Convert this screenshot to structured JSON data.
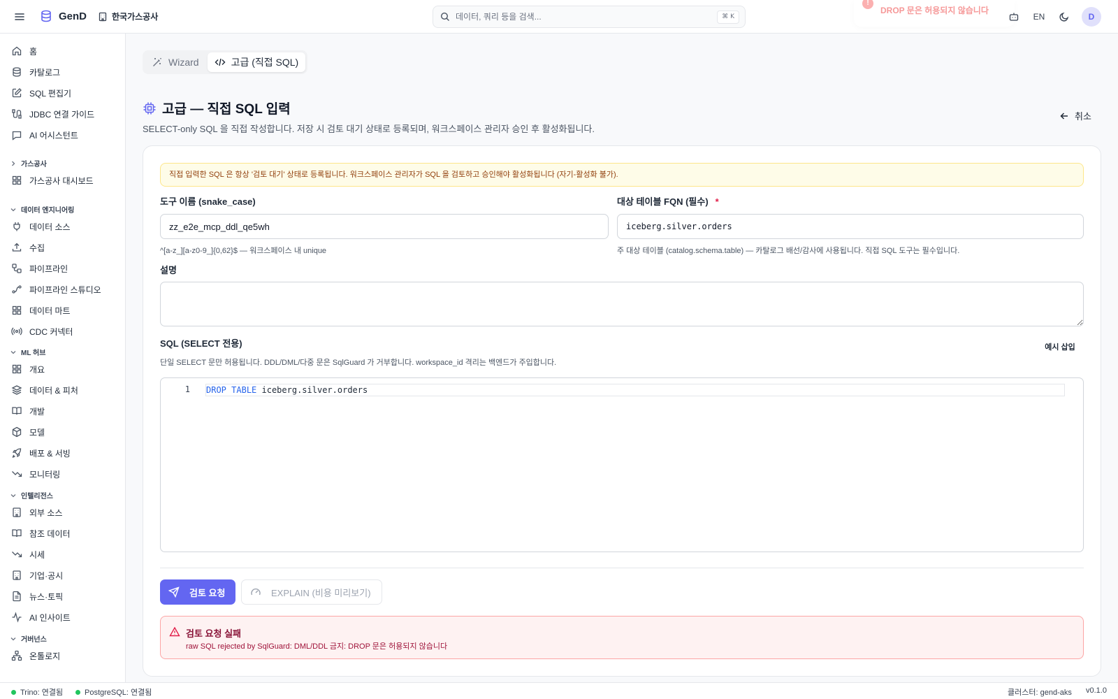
{
  "topbar": {
    "app_name": "GenD",
    "org_name": "한국가스공사",
    "search_placeholder": "데이터, 쿼리 등을 검색...",
    "search_shortcut": "⌘ K",
    "toast_message": "DROP 문은 허용되지 않습니다",
    "lang": "EN",
    "avatar_initial": "D"
  },
  "sidebar": {
    "items_top": [
      {
        "label": "홈",
        "icon": "home-icon"
      },
      {
        "label": "카탈로그",
        "icon": "database-icon"
      },
      {
        "label": "SQL 편집기",
        "icon": "edit-icon"
      },
      {
        "label": "JDBC 연결 가이드",
        "icon": "cable-icon"
      },
      {
        "label": "AI 어시스턴트",
        "icon": "message-icon"
      }
    ],
    "groups": [
      {
        "label": "가스공사",
        "items": [
          {
            "label": "가스공사 대시보드",
            "icon": "grid-icon"
          }
        ]
      },
      {
        "label": "데이터 엔지니어링",
        "items": [
          {
            "label": "데이터 소스",
            "icon": "plug-icon"
          },
          {
            "label": "수집",
            "icon": "upload-icon"
          },
          {
            "label": "파이프라인",
            "icon": "workflow-icon"
          },
          {
            "label": "파이프라인 스튜디오",
            "icon": "spline-icon"
          },
          {
            "label": "데이터 마트",
            "icon": "grid-icon"
          },
          {
            "label": "CDC 커넥터",
            "icon": "radio-icon"
          }
        ]
      },
      {
        "label": "ML 허브",
        "items": [
          {
            "label": "개요",
            "icon": "grid-icon"
          },
          {
            "label": "데이터 & 피처",
            "icon": "layers-icon"
          },
          {
            "label": "개발",
            "icon": "book-open-icon"
          },
          {
            "label": "모델",
            "icon": "box-icon"
          },
          {
            "label": "배포 & 서빙",
            "icon": "rocket-icon"
          },
          {
            "label": "모니터링",
            "icon": "trending-down-icon"
          }
        ]
      },
      {
        "label": "인텔리전스",
        "items": [
          {
            "label": "외부 소스",
            "icon": "building-icon"
          },
          {
            "label": "참조 데이터",
            "icon": "book-open-icon"
          },
          {
            "label": "시세",
            "icon": "trending-down-icon"
          },
          {
            "label": "기업·공시",
            "icon": "building-icon"
          },
          {
            "label": "뉴스·토픽",
            "icon": "file-text-icon"
          },
          {
            "label": "AI 인사이트",
            "icon": "activity-icon"
          }
        ]
      },
      {
        "label": "거버넌스",
        "items": [
          {
            "label": "온톨로지",
            "icon": "network-icon"
          }
        ]
      }
    ]
  },
  "tabs": [
    {
      "label": "Wizard"
    },
    {
      "label": "고급 (직접 SQL)"
    }
  ],
  "page": {
    "title": "고급 — 직접 SQL 입력",
    "description": "SELECT-only SQL 을 직접 작성합니다. 저장 시 검토 대기 상태로 등록되며, 워크스페이스 관리자 승인 후 활성화됩니다.",
    "cancel_label": "취소"
  },
  "form": {
    "notice": "직접 입력한 SQL 은 항상 '검토 대기' 상태로 등록됩니다. 워크스페이스 관리자가 SQL 을 검토하고 승인해야 활성화됩니다 (자기-활성화 불가).",
    "tool_name_label": "도구 이름 (snake_case)",
    "tool_name_value": "zz_e2e_mcp_ddl_qe5wh",
    "tool_name_hint": "^[a-z_][a-z0-9_]{0,62}$ — 워크스페이스 내 unique",
    "fqn_label": "대상 테이블 FQN (필수)",
    "fqn_required_mark": "*",
    "fqn_value": "iceberg.silver.orders",
    "fqn_hint": "주 대상 테이블 (catalog.schema.table) — 카탈로그 배선/감사에 사용됩니다. 직접 SQL 도구는 필수입니다.",
    "desc_label": "설명",
    "desc_value": "",
    "sql_label": "SQL (SELECT 전용)",
    "sql_example_label": "예시 삽입",
    "sql_hint": "단일 SELECT 문만 허용됩니다. DDL/DML/다중 문은 SqlGuard 가 거부합니다. workspace_id 격리는 백엔드가 주입합니다.",
    "sql_line_no": "1",
    "sql_kw1": "DROP",
    "sql_kw2": "TABLE",
    "sql_rest": "iceberg.silver.orders",
    "submit_label": "검토 요청",
    "explain_label": "EXPLAIN (비용 미리보기)",
    "error_title": "검토 요청 실패",
    "error_message": "raw SQL rejected by SqlGuard: DML/DDL 금지: DROP 문은 허용되지 않습니다"
  },
  "statusbar": {
    "trino": "Trino: 연결됨",
    "postgres": "PostgreSQL: 연결됨",
    "cluster": "클러스터: gend-aks",
    "version": "v0.1.0"
  }
}
